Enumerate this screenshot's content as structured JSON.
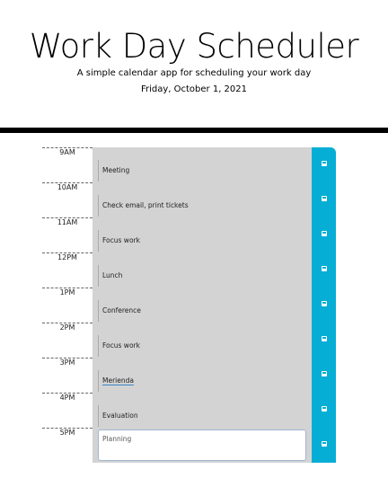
{
  "header": {
    "title": "Work Day Scheduler",
    "subtitle": "A simple calendar app for scheduling your work day",
    "date": "Friday, October 1, 2021"
  },
  "colors": {
    "save_button": "#06aed5",
    "past_row": "#d3d3d3"
  },
  "schedule": [
    {
      "hour": "9AM",
      "text": "Meeting",
      "state": "past"
    },
    {
      "hour": "10AM",
      "text": "Check email, print tickets",
      "state": "past"
    },
    {
      "hour": "11AM",
      "text": "Focus work",
      "state": "past"
    },
    {
      "hour": "12PM",
      "text": "Lunch",
      "state": "past"
    },
    {
      "hour": "1PM",
      "text": "Conference",
      "state": "past"
    },
    {
      "hour": "2PM",
      "text": "Focus work",
      "state": "past"
    },
    {
      "hour": "3PM",
      "text": "Merienda",
      "state": "past"
    },
    {
      "hour": "4PM",
      "text": "Evaluation",
      "state": "past"
    },
    {
      "hour": "5PM",
      "text": "Planning",
      "state": "editing"
    }
  ]
}
